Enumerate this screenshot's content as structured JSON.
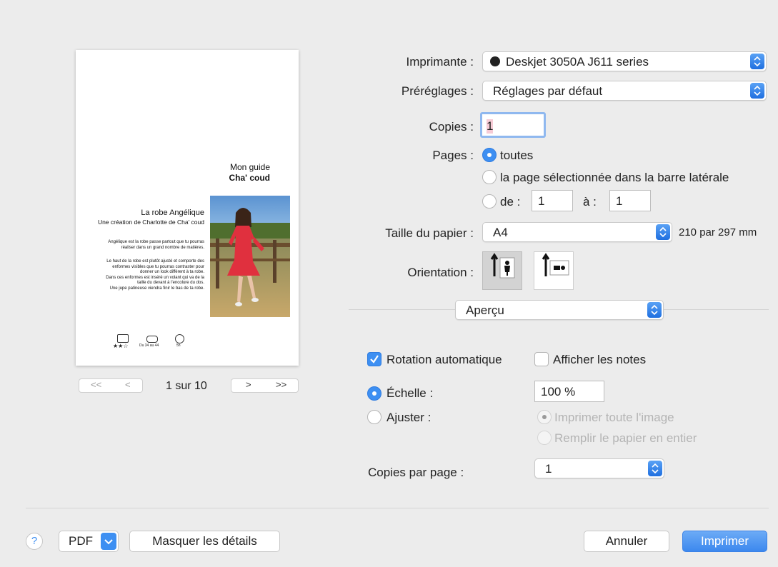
{
  "preview": {
    "guide_title": "Mon guide",
    "guide_subtitle": "Cha' coud",
    "dress_title": "La robe Angélique",
    "dress_subtitle": "Une création de Charlotte de Cha' coud",
    "paragraph1": "Angélique est la robe passe partout que tu pourras réaliser dans un grand nombre de matières.",
    "paragraph2_lines": [
      "Le haut de la robe est plutôt ajusté et comporte des",
      "enformes visibles que tu pourras contraster pour",
      "donner un look différent à ta robe.",
      "Dans ces enformes est inséré un volant qui va de la",
      "taille du devant à l'encolure du dos.",
      "Une jupe patineuse viendra finir le bas de ta robe."
    ],
    "paragraph1_lines": [
      "Angélique est la robe passe partout que tu pourras",
      "réaliser dans un grand nombre de matières."
    ],
    "difficulty_stars": "★★☆",
    "size_range": "Du 34 au 44",
    "duration": "5h",
    "page_indicator": "1 sur 10",
    "first_label": "<<",
    "prev_label": "<",
    "next_label": ">",
    "last_label": ">>"
  },
  "settings": {
    "printer_label": "Imprimante :",
    "printer_value": "Deskjet 3050A J611 series",
    "presets_label": "Préréglages :",
    "presets_value": "Réglages par défaut",
    "copies_label": "Copies :",
    "copies_value": "1",
    "pages_label": "Pages :",
    "pages_all": "toutes",
    "pages_selected": "la page sélectionnée dans la barre latérale",
    "pages_from": "de :",
    "from_value": "1",
    "pages_to": "à :",
    "to_value": "1",
    "paper_label": "Taille du papier :",
    "paper_value": "A4",
    "paper_dims": "210 par 297 mm",
    "orientation_label": "Orientation :",
    "section_value": "Aperçu"
  },
  "preview_options": {
    "auto_rotate": "Rotation automatique",
    "show_notes": "Afficher les notes",
    "scale_label": "Échelle :",
    "scale_value": "100 %",
    "fit_label": "Ajuster :",
    "print_entire": "Imprimer toute l'image",
    "fill_paper": "Remplir le papier en entier",
    "copies_per_page_label": "Copies par page :",
    "copies_per_page_value": "1"
  },
  "footer": {
    "help": "?",
    "pdf": "PDF",
    "hide_details": "Masquer les détails",
    "cancel": "Annuler",
    "print": "Imprimer"
  },
  "colors": {
    "accent": "#3d8ff2",
    "background": "#ececec"
  }
}
